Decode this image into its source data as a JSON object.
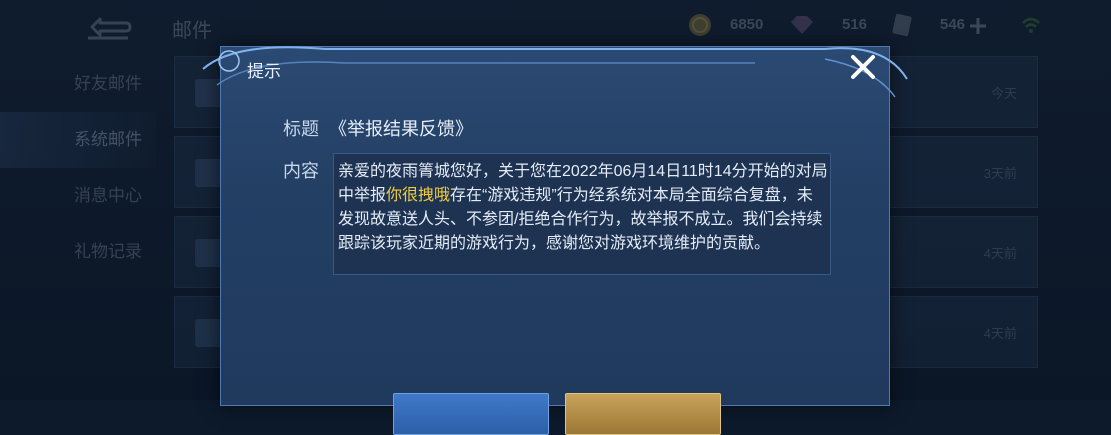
{
  "header": {
    "page_title": "邮件",
    "resources": [
      {
        "icon": "gold-coin-icon",
        "value": "6850"
      },
      {
        "icon": "gem-icon",
        "value": "516"
      },
      {
        "icon": "voucher-icon",
        "value": "546"
      }
    ],
    "add_icon": "plus-icon",
    "signal_icon": "wifi-signal-icon"
  },
  "sidebar": {
    "items": [
      {
        "label": "好友邮件",
        "active": false
      },
      {
        "label": "系统邮件",
        "active": true
      },
      {
        "label": "消息中心",
        "active": false
      },
      {
        "label": "礼物记录",
        "active": false
      }
    ]
  },
  "mail_list": {
    "items": [
      {
        "time": "今天"
      },
      {
        "time": "3天前"
      },
      {
        "time": "4天前"
      },
      {
        "time": "4天前"
      }
    ]
  },
  "dialog": {
    "title": "提示",
    "subject_label": "标题",
    "subject": "《举报结果反馈》",
    "content_label": "内容",
    "content_part1": "亲爱的夜雨箐城您好，关于您在2022年06月14日11时14分开始的对局中举报",
    "content_highlight": "你很拽哦",
    "content_part2": "存在“游戏违规”行为经系统对本局全面综合复盘，未发现故意送人头、不参团/拒绝合作行为，故举报不成立。我们会持续跟踪该玩家近期的游戏行为，感谢您对游戏环境维护的贡献。",
    "colors": {
      "highlight": "#f3cd3c",
      "accent": "#4f79b0"
    }
  }
}
